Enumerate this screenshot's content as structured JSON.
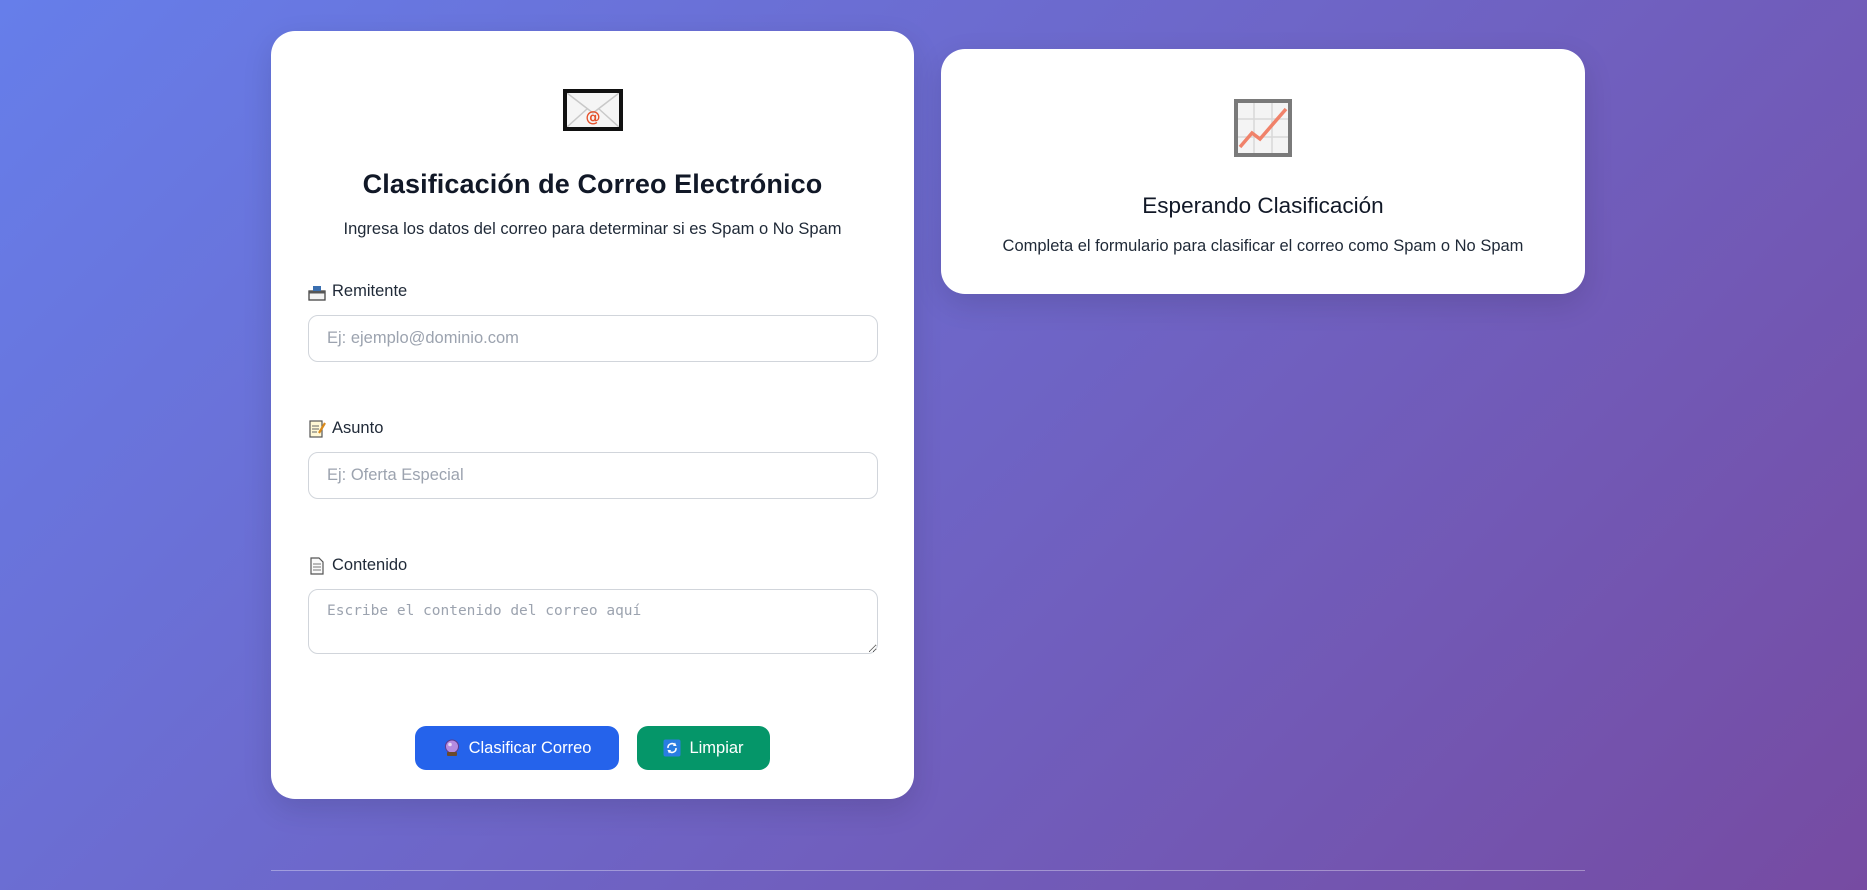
{
  "form": {
    "icon": "envelope-icon",
    "title": "Clasificación de Correo Electrónico",
    "subtitle": "Ingresa los datos del correo para determinar si es Spam o No Spam",
    "fields": {
      "remitente": {
        "icon": "outbox-tray-icon",
        "label": "Remitente",
        "value": "",
        "placeholder": "Ej: ejemplo@dominio.com"
      },
      "asunto": {
        "icon": "memo-icon",
        "label": "Asunto",
        "value": "",
        "placeholder": "Ej: Oferta Especial"
      },
      "contenido": {
        "icon": "page-icon",
        "label": "Contenido",
        "value": "",
        "placeholder": "Escribe el contenido del correo aquí"
      }
    },
    "buttons": {
      "classify": {
        "icon": "crystal-ball-icon",
        "label": "Clasificar Correo",
        "color": "#2563eb"
      },
      "clear": {
        "icon": "refresh-icon",
        "label": "Limpiar",
        "color": "#059669"
      }
    }
  },
  "result": {
    "icon": "chart-increasing-icon",
    "title": "Esperando Clasificación",
    "text": "Completa el formulario para clasificar el correo como Spam o No Spam"
  },
  "theme": {
    "background_start": "#667eea",
    "background_end": "#764ba2"
  }
}
